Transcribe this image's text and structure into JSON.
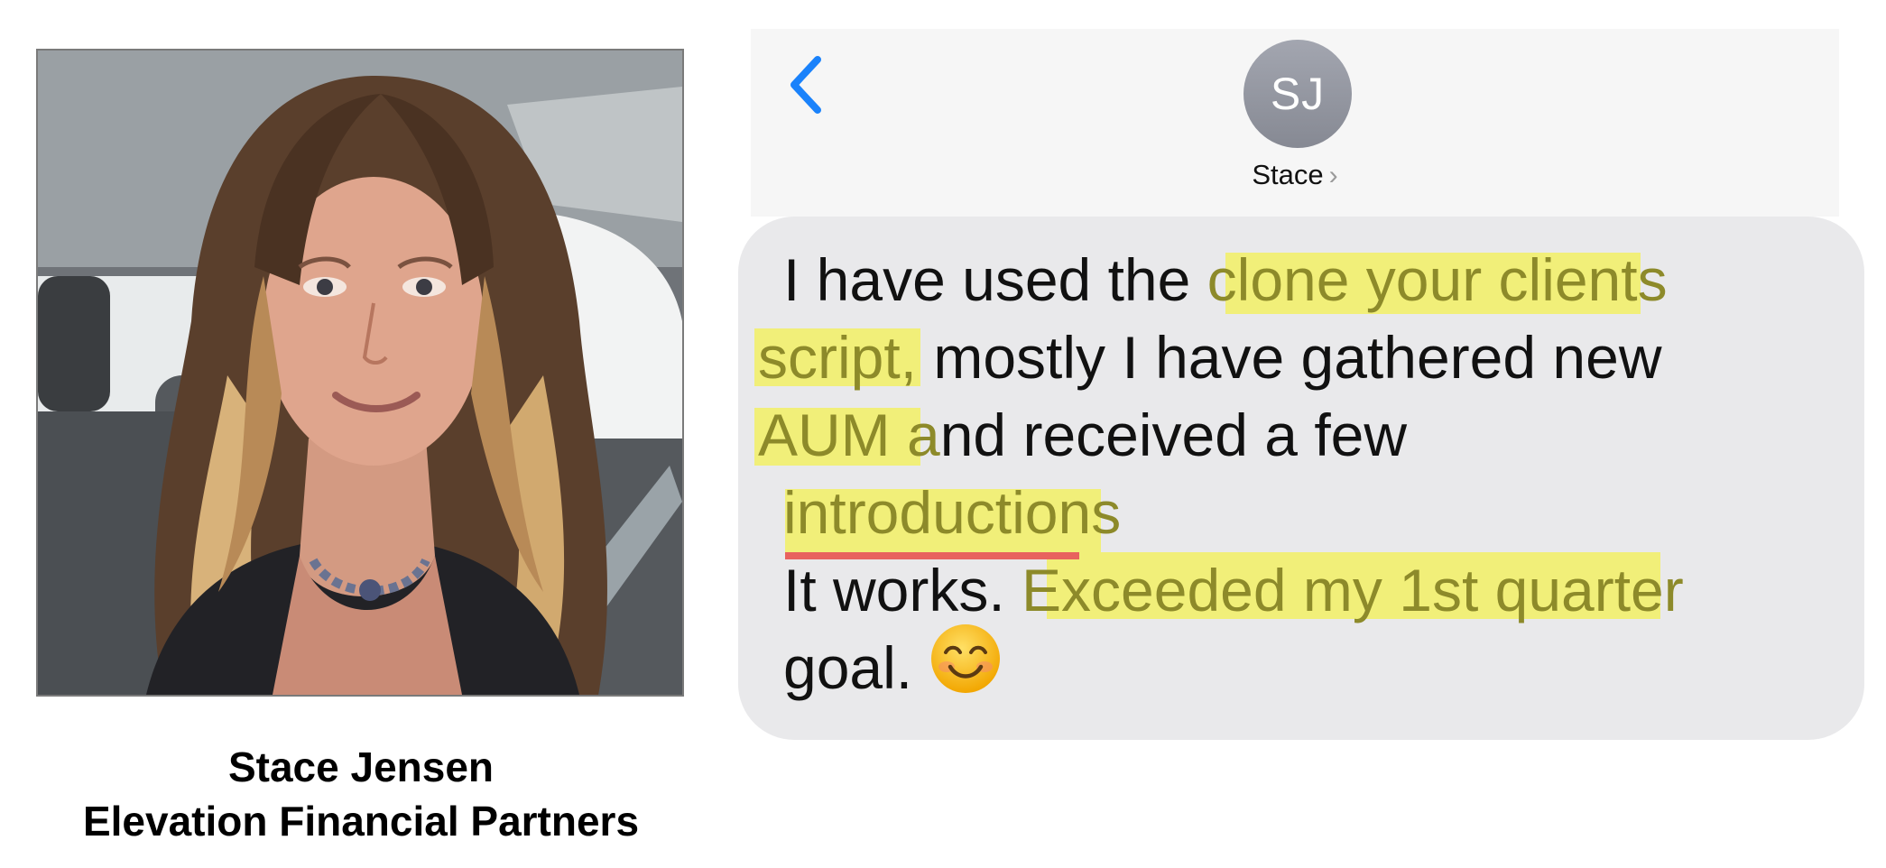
{
  "photo": {
    "alt_icon": "portrait-photo"
  },
  "caption": {
    "name": "Stace Jensen",
    "company": "Elevation Financial Partners"
  },
  "header": {
    "back_icon": "chevron-left-icon",
    "avatar_initials": "SJ",
    "contact_name": "Stace",
    "contact_chevron": "›"
  },
  "message": {
    "line1_plain": "I have used the",
    "line1_hl": " clone your  clients ",
    "line2_hl": " script,",
    "line2_plain": " mostly I have gathered new",
    "line3_hl": " AUM a",
    "line3_plain": "nd received a few",
    "line4_hl": "introductions",
    "line5_plain": " It works.",
    "line5_hl": " Exceeded my 1st quarter ",
    "line6_plain": "goal.",
    "emoji": "smiling-face-emoji"
  },
  "colors": {
    "highlight": "#f1ef79",
    "underline": "#e8625e",
    "bubble": "#e9e9eb",
    "ios_blue": "#1a82fb"
  }
}
